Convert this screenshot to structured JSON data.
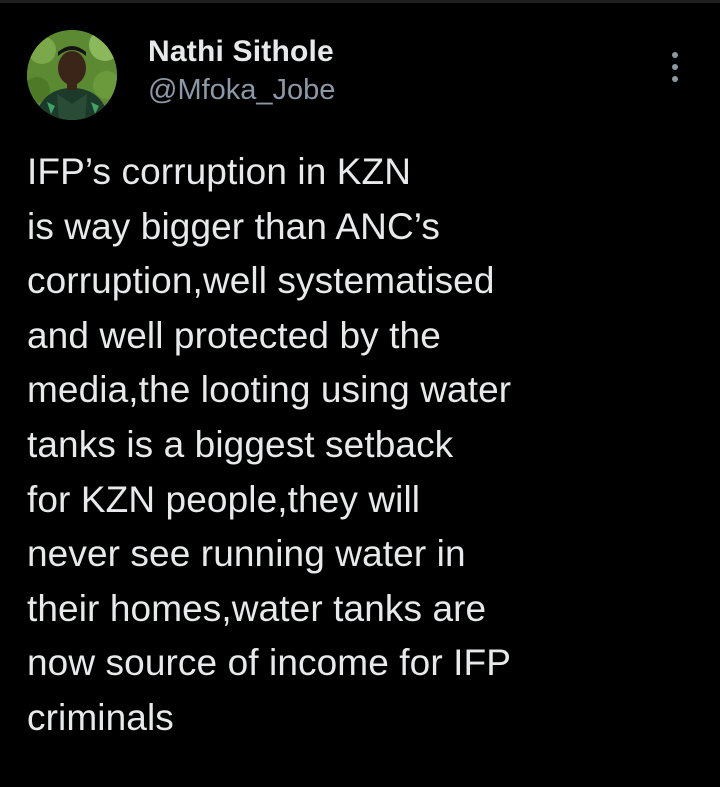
{
  "author": {
    "display_name": "Nathi Sithole",
    "handle": "@Mfoka_Jobe",
    "avatar_icon": "user-avatar-photo"
  },
  "menu": {
    "icon": "more-vertical-icon"
  },
  "tweet": {
    "text": "IFP’s corruption in KZN\nis way bigger than ANC’s\ncorruption,well systematised\nand well protected by the\nmedia,the looting using water\ntanks is a biggest setback\nfor KZN people,they will\nnever see running water in\ntheir homes,water tanks are\nnow source of income for IFP\ncriminals"
  },
  "colors": {
    "background": "#000000",
    "primary_text": "#e7e9ea",
    "secondary_text": "#8b98a5"
  }
}
